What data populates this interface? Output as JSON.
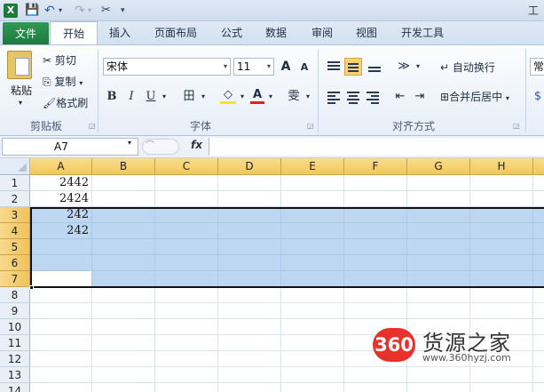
{
  "window": {
    "title": "工"
  },
  "qat": {
    "logo": "X",
    "save": "💾",
    "undo": "↶",
    "redo": "↷",
    "custom": "✂",
    "more": "▾"
  },
  "tabs": [
    "文件",
    "开始",
    "插入",
    "页面布局",
    "公式",
    "数据",
    "审阅",
    "视图",
    "开发工具"
  ],
  "clipboard": {
    "paste": "粘贴",
    "cut": "剪切",
    "copy": "复制",
    "format_painter": "格式刷",
    "group": "剪贴板"
  },
  "font": {
    "name": "宋体",
    "size": "11",
    "grow": "A",
    "shrink": "A",
    "bold": "B",
    "italic": "I",
    "underline": "U",
    "border": "田",
    "fill": "◇",
    "font_color": "A",
    "phonetic": "雯",
    "group": "字体"
  },
  "alignment": {
    "wrap_text": "自动换行",
    "merge_center": "合并后居中",
    "group": "对齐方式"
  },
  "number": {
    "format": "常"
  },
  "formula_bar": {
    "name_box": "A7",
    "fx": "fx",
    "formula": ""
  },
  "grid": {
    "columns": [
      "A",
      "B",
      "C",
      "D",
      "E",
      "F",
      "G",
      "H"
    ],
    "rows": [
      "1",
      "2",
      "3",
      "4",
      "5",
      "6",
      "7",
      "8",
      "9",
      "10",
      "11",
      "12",
      "13",
      "14"
    ],
    "cells": {
      "1": "2442",
      "2": "2424",
      "3": "242",
      "4": "242"
    },
    "selected_rows": [
      "3",
      "4",
      "5",
      "6",
      "7"
    ],
    "active_cell": "A7"
  },
  "colors": {
    "accent": "#1d7a3c",
    "selection": "#bdd7f2",
    "header_highlight": "#f3c85b"
  },
  "watermark": {
    "logo": "360",
    "title": "货源之家",
    "url": "www.360hyzj.com"
  }
}
